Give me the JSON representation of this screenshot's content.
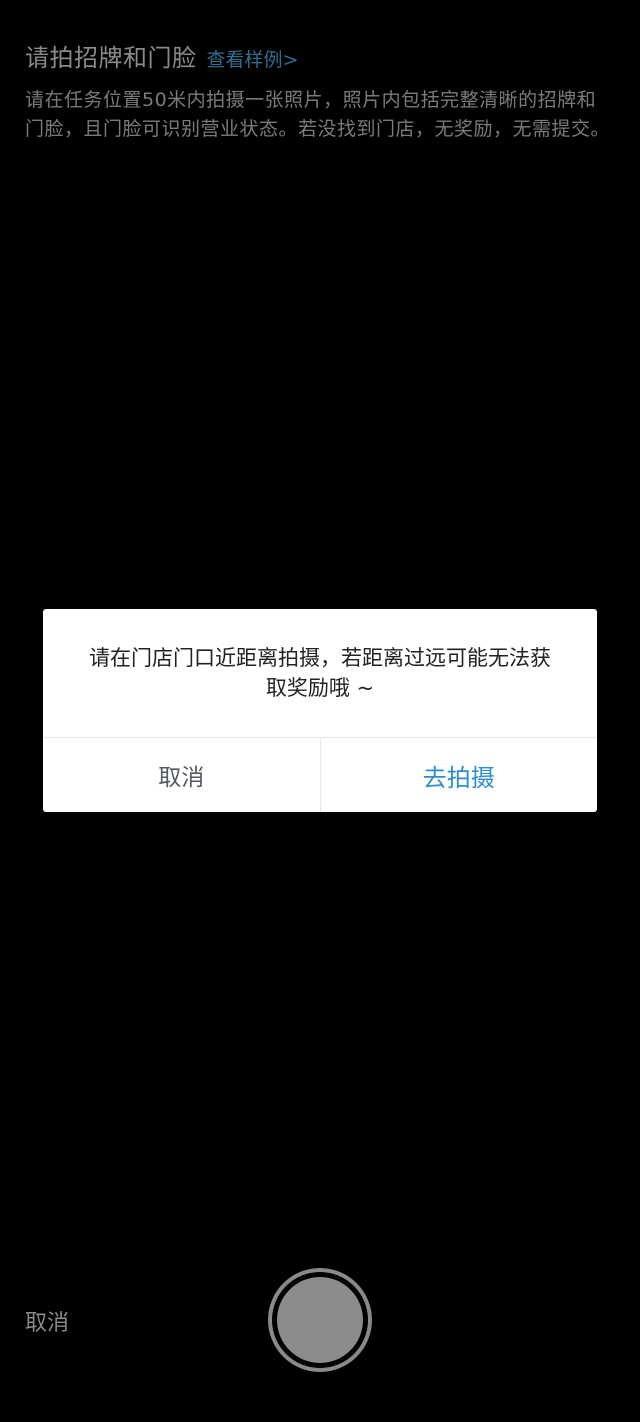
{
  "header": {
    "title": "请拍招牌和门脸",
    "example_link": "查看样例>",
    "description": "请在任务位置50米内拍摄一张照片，照片内包括完整清晰的招牌和门脸，且门脸可识别营业状态。若没找到门店，无奖励，无需提交。"
  },
  "dialog": {
    "message_line1": "请在门店门口近距离拍摄，若距离过远可能无法获",
    "message_line2": "取奖励哦 ~",
    "cancel_label": "取消",
    "confirm_label": "去拍摄"
  },
  "camera": {
    "cancel_label": "取消"
  },
  "colors": {
    "background": "#000000",
    "link": "#2f6e8f",
    "confirm": "#2e8fd0"
  }
}
